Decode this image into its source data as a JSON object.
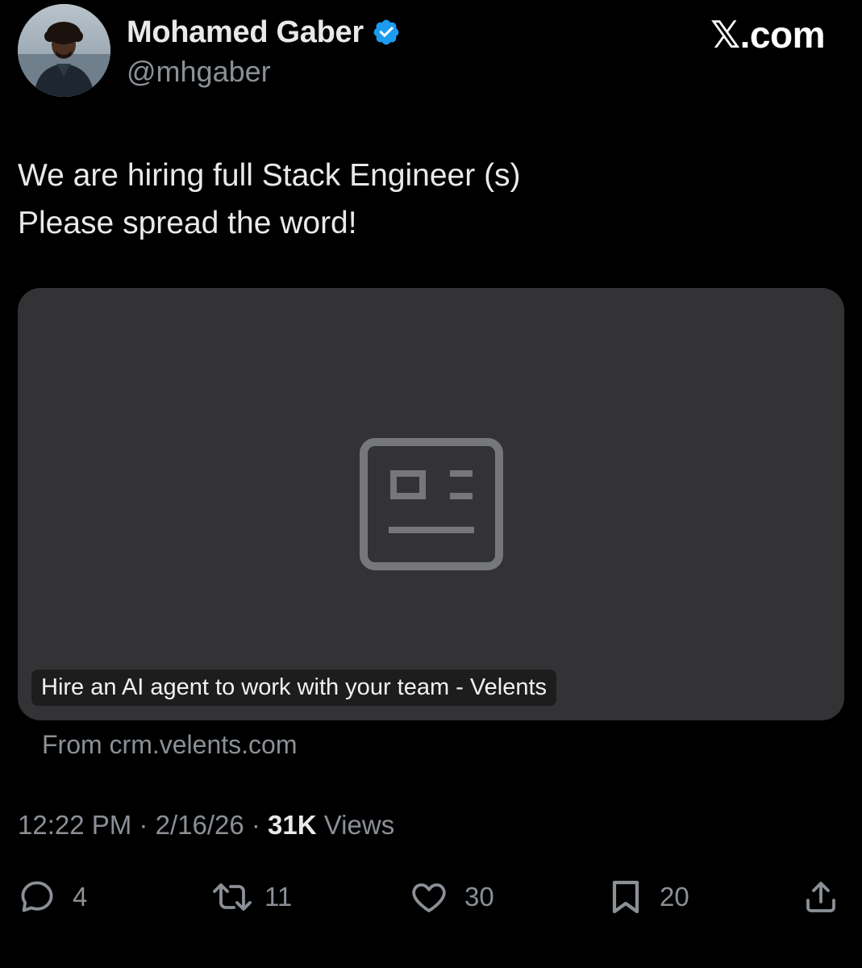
{
  "author": {
    "name": "Mohamed Gaber",
    "handle": "@mhgaber",
    "verified": true
  },
  "brand": "𝕏.com",
  "tweet": {
    "lines": [
      "We are hiring full Stack Engineer (s)",
      "Please spread the word!"
    ]
  },
  "card": {
    "icon": "news-article-icon",
    "title": "Hire an AI agent to work with your team - Velents",
    "source": "From crm.velents.com"
  },
  "meta": {
    "time": "12:22 PM",
    "separator": "·",
    "date": "2/16/26",
    "views_count": "31K",
    "views_label": "Views"
  },
  "actions": {
    "reply": {
      "icon": "reply-icon",
      "count": "4"
    },
    "retweet": {
      "icon": "retweet-icon",
      "count": "11"
    },
    "like": {
      "icon": "heart-icon",
      "count": "30"
    },
    "bookmark": {
      "icon": "bookmark-icon",
      "count": "20"
    },
    "share": {
      "icon": "share-icon"
    }
  },
  "colors": {
    "background": "#000000",
    "primary_text": "#e7e9ea",
    "secondary_text": "#8b9096",
    "verified_blue": "#1d9bf0",
    "card_background": "#333336"
  }
}
